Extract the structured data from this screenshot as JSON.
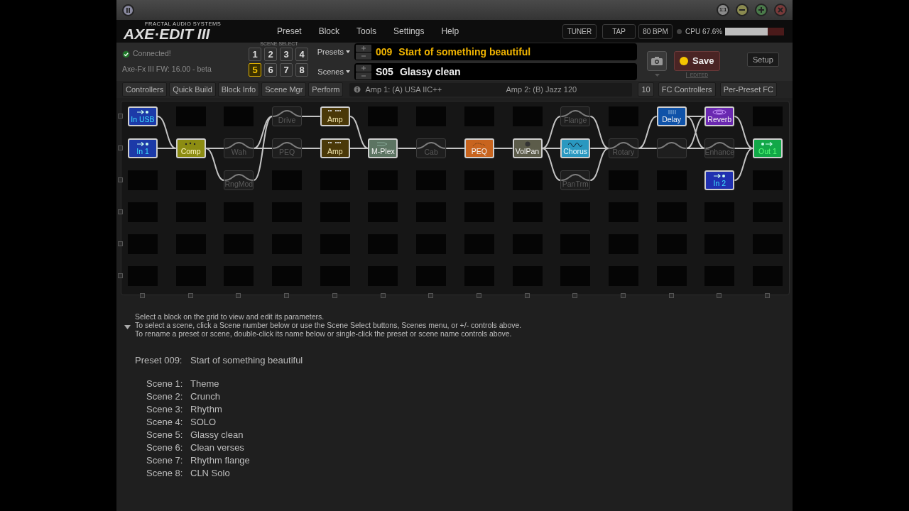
{
  "title_bar": {
    "zoom_button": "1:1"
  },
  "logo": {
    "brand": "FRACTAL AUDIO SYSTEMS",
    "product": "AXE·EDIT III"
  },
  "menu": [
    "Preset",
    "Block",
    "Tools",
    "Settings",
    "Help"
  ],
  "header_buttons": [
    "TUNER",
    "TAP",
    "80 BPM"
  ],
  "cpu": {
    "label": "CPU 67.6%",
    "level": 0.72
  },
  "connection": {
    "status": "Connected!",
    "connected": true,
    "firmware": "Axe-Fx III FW: 16.00 - beta"
  },
  "scene_select": {
    "label": "SCENE SELECT",
    "buttons": [
      {
        "label": "1",
        "selected": false
      },
      {
        "label": "2",
        "selected": false
      },
      {
        "label": "3",
        "selected": false
      },
      {
        "label": "4",
        "selected": false
      },
      {
        "label": "5",
        "selected": true
      },
      {
        "label": "6",
        "selected": false
      },
      {
        "label": "7",
        "selected": false
      },
      {
        "label": "8",
        "selected": false
      }
    ]
  },
  "preset": {
    "menu": "Presets",
    "number": "009",
    "name": "Start of something beautiful"
  },
  "scene": {
    "menu": "Scenes",
    "number": "S05",
    "name": "Glassy clean"
  },
  "save": {
    "label": "Save",
    "edited": true,
    "edited_label": "EDITED"
  },
  "setup": "Setup",
  "toolbar": [
    "Controllers",
    "Quick Build",
    "Block Info",
    "Scene Mgr",
    "Perform"
  ],
  "amp_info": [
    "Amp 1: (A) USA IIC++",
    "Amp 2: (B) Jazz 120"
  ],
  "fc_count": "10",
  "fc_buttons": [
    "FC Controllers",
    "Per-Preset FC"
  ],
  "grid": {
    "rows": [
      {
        "cells": [
          {
            "kind": "input",
            "label": "In USB",
            "engaged": true,
            "color": "#1c3aa8"
          },
          {
            "kind": "empty"
          },
          {
            "kind": "empty"
          },
          {
            "kind": "effect",
            "label": "Drive",
            "engaged": false
          },
          {
            "kind": "amp",
            "label": "Amp",
            "engaged": true,
            "color": "#4a3808"
          },
          {
            "kind": "empty"
          },
          {
            "kind": "empty"
          },
          {
            "kind": "empty"
          },
          {
            "kind": "empty"
          },
          {
            "kind": "effect",
            "label": "Flange",
            "engaged": false
          },
          {
            "kind": "empty"
          },
          {
            "kind": "delay",
            "label": "Delay",
            "engaged": true,
            "color": "#0f52a8"
          },
          {
            "kind": "reverb",
            "label": "Reverb",
            "engaged": true,
            "color": "#6a28b0"
          },
          {
            "kind": "empty"
          }
        ]
      },
      {
        "cells": [
          {
            "kind": "input",
            "label": "In 1",
            "engaged": true,
            "color": "#1c3aa8"
          },
          {
            "kind": "comp",
            "label": "Comp",
            "engaged": true,
            "color": "#8c8c12"
          },
          {
            "kind": "effect",
            "label": "Wah",
            "engaged": false
          },
          {
            "kind": "effect",
            "label": "PEQ",
            "engaged": false
          },
          {
            "kind": "amp",
            "label": "Amp",
            "engaged": true,
            "color": "#4a3808"
          },
          {
            "kind": "mplex",
            "label": "M-Plex",
            "engaged": true,
            "color": "#5c7462"
          },
          {
            "kind": "effect",
            "label": "Cab",
            "engaged": false
          },
          {
            "kind": "peq",
            "label": "PEQ",
            "engaged": true,
            "color": "#c8641e"
          },
          {
            "kind": "volpan",
            "label": "VolPan",
            "engaged": true,
            "color": "#5c5c4a"
          },
          {
            "kind": "chorus",
            "label": "Chorus",
            "engaged": true,
            "color": "#2a98c0"
          },
          {
            "kind": "effect",
            "label": "Rotary",
            "engaged": false
          },
          {
            "kind": "shunt"
          },
          {
            "kind": "effect",
            "label": "Enhance",
            "engaged": false
          },
          {
            "kind": "output",
            "label": "Out 1",
            "engaged": true,
            "color": "#12a848"
          }
        ]
      },
      {
        "cells": [
          {
            "kind": "empty"
          },
          {
            "kind": "empty"
          },
          {
            "kind": "effect",
            "label": "RngMod",
            "engaged": false
          },
          {
            "kind": "empty"
          },
          {
            "kind": "empty"
          },
          {
            "kind": "empty"
          },
          {
            "kind": "empty"
          },
          {
            "kind": "empty"
          },
          {
            "kind": "empty"
          },
          {
            "kind": "effect",
            "label": "PanTrm",
            "engaged": false
          },
          {
            "kind": "empty"
          },
          {
            "kind": "empty"
          },
          {
            "kind": "input",
            "label": "In 2",
            "engaged": true,
            "color": "#2030b0"
          },
          {
            "kind": "empty"
          }
        ]
      },
      {
        "cells": [
          {
            "kind": "empty"
          },
          {
            "kind": "empty"
          },
          {
            "kind": "empty"
          },
          {
            "kind": "empty"
          },
          {
            "kind": "empty"
          },
          {
            "kind": "empty"
          },
          {
            "kind": "empty"
          },
          {
            "kind": "empty"
          },
          {
            "kind": "empty"
          },
          {
            "kind": "empty"
          },
          {
            "kind": "empty"
          },
          {
            "kind": "empty"
          },
          {
            "kind": "empty"
          },
          {
            "kind": "empty"
          }
        ]
      },
      {
        "cells": [
          {
            "kind": "empty"
          },
          {
            "kind": "empty"
          },
          {
            "kind": "empty"
          },
          {
            "kind": "empty"
          },
          {
            "kind": "empty"
          },
          {
            "kind": "empty"
          },
          {
            "kind": "empty"
          },
          {
            "kind": "empty"
          },
          {
            "kind": "empty"
          },
          {
            "kind": "empty"
          },
          {
            "kind": "empty"
          },
          {
            "kind": "empty"
          },
          {
            "kind": "empty"
          },
          {
            "kind": "empty"
          }
        ]
      },
      {
        "cells": [
          {
            "kind": "empty"
          },
          {
            "kind": "empty"
          },
          {
            "kind": "empty"
          },
          {
            "kind": "empty"
          },
          {
            "kind": "empty"
          },
          {
            "kind": "empty"
          },
          {
            "kind": "empty"
          },
          {
            "kind": "empty"
          },
          {
            "kind": "empty"
          },
          {
            "kind": "empty"
          },
          {
            "kind": "empty"
          },
          {
            "kind": "empty"
          },
          {
            "kind": "empty"
          },
          {
            "kind": "empty"
          }
        ]
      }
    ]
  },
  "help": {
    "expanded": true,
    "lines": [
      "Select a block on the grid to view and edit its parameters.",
      "To select a scene, click a Scene number below or use the Scene Select buttons, Scenes menu, or +/- controls above.",
      "To rename a preset or scene, double-click its name below or single-click the preset or scene name controls above."
    ]
  },
  "summary": {
    "preset_label": "Preset 009:",
    "preset_name": "Start of something beautiful",
    "scenes": [
      {
        "label": "Scene 1:",
        "name": "Theme"
      },
      {
        "label": "Scene 2:",
        "name": "Crunch"
      },
      {
        "label": "Scene 3:",
        "name": "Rhythm"
      },
      {
        "label": "Scene 4:",
        "name": "SOLO"
      },
      {
        "label": "Scene 5:",
        "name": "Glassy clean"
      },
      {
        "label": "Scene 6:",
        "name": "Clean verses"
      },
      {
        "label": "Scene 7:",
        "name": "Rhythm flange"
      },
      {
        "label": "Scene 8:",
        "name": "CLN Solo"
      }
    ]
  }
}
